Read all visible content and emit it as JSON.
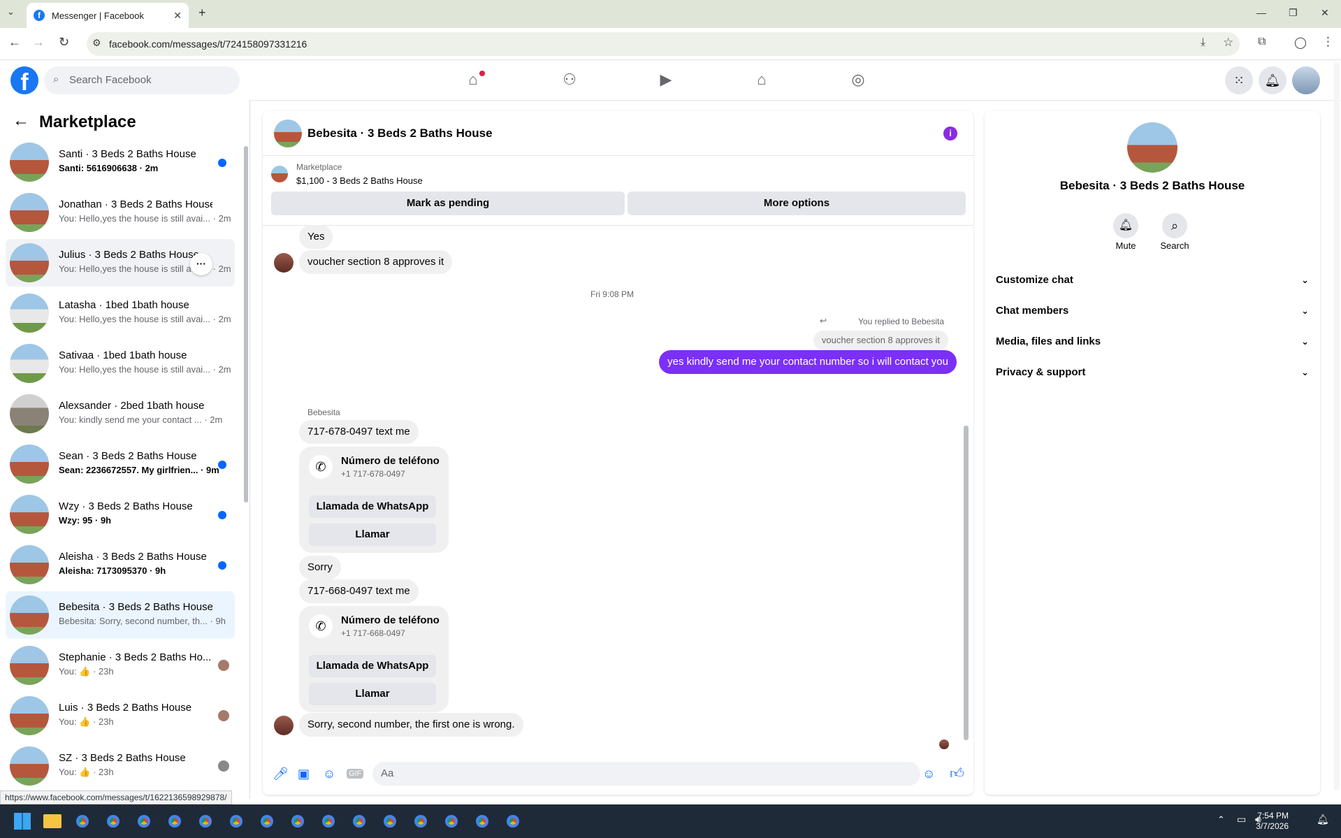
{
  "browser": {
    "tab_title": "Messenger | Facebook",
    "tab_favicon": "f",
    "url": "facebook.com/messages/t/724158097331216",
    "status_url": "https://www.facebook.com/messages/t/1622136598929878/"
  },
  "fb": {
    "logo": "f",
    "search_placeholder": "Search Facebook"
  },
  "sidebar": {
    "title": "Marketplace",
    "conversations": [
      {
        "name": "Santi · 3 Beds 2 Baths House",
        "preview": "Santi: 5616906638 · 2m",
        "unread": true
      },
      {
        "name": "Jonathan · 3 Beds 2 Baths House",
        "preview": "You: Hello,yes the house is still avai... · 2m",
        "unread": false
      },
      {
        "name": "Julius · 3 Beds 2 Baths House",
        "preview": "You: Hello,yes the house is still avai... · 2m",
        "unread": false
      },
      {
        "name": "Latasha · 1bed 1bath house",
        "preview": "You: Hello,yes the house is still avai... · 2m",
        "unread": false
      },
      {
        "name": "Sativaa · 1bed 1bath house",
        "preview": "You: Hello,yes the house is still avai... · 2m",
        "unread": false
      },
      {
        "name": "Alexsander · 2bed 1bath house",
        "preview": "You: kindly send me your contact ... · 2m",
        "unread": false
      },
      {
        "name": "Sean · 3 Beds 2 Baths House",
        "preview": "Sean: 2236672557. My girlfrien... · 9m",
        "unread": true
      },
      {
        "name": "Wzy · 3 Beds 2 Baths House",
        "preview": "Wzy: 95 · 9h",
        "unread": true
      },
      {
        "name": "Aleisha · 3 Beds 2 Baths House",
        "preview": "Aleisha: 7173095370 · 9h",
        "unread": true
      },
      {
        "name": "Bebesita · 3 Beds 2 Baths House",
        "preview": "Bebesita: Sorry, second number, th... · 9h",
        "unread": false
      },
      {
        "name": "Stephanie · 3 Beds 2 Baths Ho...",
        "preview": "You: 👍 · 23h",
        "unread": false
      },
      {
        "name": "Luis · 3 Beds 2 Baths House",
        "preview": "You: 👍 · 23h",
        "unread": false
      },
      {
        "name": "SZ · 3 Beds 2 Baths House",
        "preview": "You: 👍 · 23h",
        "unread": false
      }
    ],
    "more_glyph": "···"
  },
  "chat": {
    "title": "Bebesita · 3 Beds 2 Baths House",
    "info_glyph": "i",
    "marketplace_label": "Marketplace",
    "listing": "$1,100 - 3 Beds 2 Baths House",
    "mark_pending": "Mark as pending",
    "more_options": "More options",
    "msg_yes": "Yes",
    "msg_voucher": "voucher section 8 approves it",
    "timestamp": "Fri 9:08 PM",
    "replied_label": "You replied to Bebesita",
    "replied_quote": "voucher section 8 approves it",
    "my_message": "yes kindly send me your contact number so i will contact you",
    "sender": "Bebesita",
    "msg_phone1": "717-678-0497 text me",
    "card1_title": "Número de teléfono",
    "card1_number": "+1 717-678-0497",
    "card_whatsapp": "Llamada de WhatsApp",
    "card_call": "Llamar",
    "msg_sorry": "Sorry",
    "msg_phone2": "717-668-0497 text me",
    "card2_title": "Número de teléfono",
    "card2_number": "+1 717-668-0497",
    "msg_last": "Sorry, second number, the first one is wrong.",
    "input_placeholder": "Aa"
  },
  "panel": {
    "title": "Bebesita · 3 Beds 2 Baths House",
    "mute": "Mute",
    "search": "Search",
    "rows": [
      "Customize chat",
      "Chat members",
      "Media, files and links",
      "Privacy & support"
    ]
  },
  "taskbar": {
    "time": "7:54 PM",
    "date": "3/7/2026"
  },
  "colors": {
    "brand": "#1877f2",
    "my_bubble": "#7b2ff7",
    "unread_dot": "#0866ff"
  }
}
